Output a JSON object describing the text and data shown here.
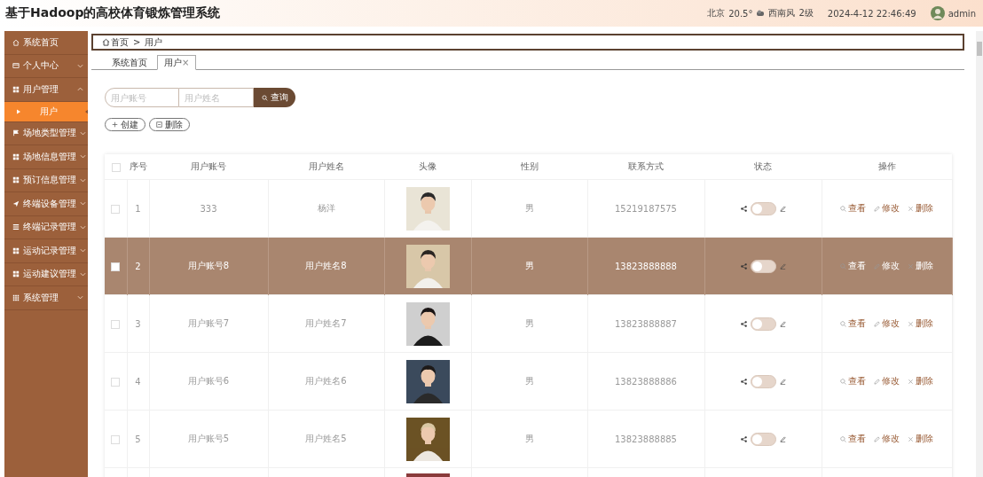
{
  "header": {
    "title": "基于Hadoop的高校体育锻炼管理系统",
    "city": "北京",
    "temperature": "20.5°",
    "wind": "西南风",
    "wind_level": "2级",
    "datetime": "2024-4-12 22:46:49",
    "user": "admin"
  },
  "sidebar": {
    "items": [
      {
        "label": "系统首页",
        "kind": "link"
      },
      {
        "label": "个人中心",
        "kind": "menu",
        "expanded": false
      },
      {
        "label": "用户管理",
        "kind": "menu",
        "expanded": true,
        "children": [
          {
            "label": "用户",
            "selected": true
          }
        ]
      },
      {
        "label": "场地类型管理",
        "kind": "menu",
        "expanded": false
      },
      {
        "label": "场地信息管理",
        "kind": "menu",
        "expanded": false
      },
      {
        "label": "预订信息管理",
        "kind": "menu",
        "expanded": false
      },
      {
        "label": "终端设备管理",
        "kind": "menu",
        "expanded": false
      },
      {
        "label": "终端记录管理",
        "kind": "menu",
        "expanded": false
      },
      {
        "label": "运动记录管理",
        "kind": "menu",
        "expanded": false
      },
      {
        "label": "运动建议管理",
        "kind": "menu",
        "expanded": false
      },
      {
        "label": "系统管理",
        "kind": "menu",
        "expanded": false
      }
    ]
  },
  "breadcrumb": {
    "items": [
      "首页",
      "用户"
    ],
    "separator": ">"
  },
  "tabs": [
    {
      "label": "系统首页",
      "selected": false
    },
    {
      "label": "用户",
      "selected": true,
      "close": "×"
    }
  ],
  "search": {
    "fields": [
      {
        "placeholder": "用户账号"
      },
      {
        "placeholder": "用户姓名"
      }
    ],
    "button": "查询"
  },
  "actions": [
    {
      "label": "创建",
      "kind": "add"
    },
    {
      "label": "删除",
      "kind": "delete"
    }
  ],
  "table": {
    "select_all": {
      "checked": false
    },
    "columns": [
      "序号",
      "用户账号",
      "用户姓名",
      "头像",
      "性别",
      "联系方式",
      "状态",
      "操作"
    ],
    "rows": [
      {
        "kind": "full",
        "index": "1",
        "account": "333",
        "name": "杨洋",
        "gender": "男",
        "phone": "15219187575",
        "status_on": false,
        "checked": false,
        "selected": false,
        "actions": [
          "查看",
          "修改",
          "删除"
        ]
      },
      {
        "kind": "full",
        "index": "2",
        "account": "用户账号8",
        "name": "用户姓名8",
        "gender": "男",
        "phone": "13823888888",
        "status_on": false,
        "checked": false,
        "selected": true,
        "actions": [
          "查看",
          "修改",
          "删除"
        ]
      },
      {
        "kind": "full",
        "index": "3",
        "account": "用户账号7",
        "name": "用户姓名7",
        "gender": "男",
        "phone": "13823888887",
        "status_on": false,
        "checked": false,
        "selected": false,
        "actions": [
          "查看",
          "修改",
          "删除"
        ]
      },
      {
        "kind": "full",
        "index": "4",
        "account": "用户账号6",
        "name": "用户姓名6",
        "gender": "男",
        "phone": "13823888886",
        "status_on": false,
        "checked": false,
        "selected": false,
        "actions": [
          "查看",
          "修改",
          "删除"
        ]
      },
      {
        "kind": "full",
        "index": "5",
        "account": "用户账号5",
        "name": "用户姓名5",
        "gender": "男",
        "phone": "13823888885",
        "status_on": false,
        "checked": false,
        "selected": false,
        "actions": [
          "查看",
          "修改",
          "删除"
        ]
      },
      {
        "kind": "cut"
      }
    ]
  }
}
